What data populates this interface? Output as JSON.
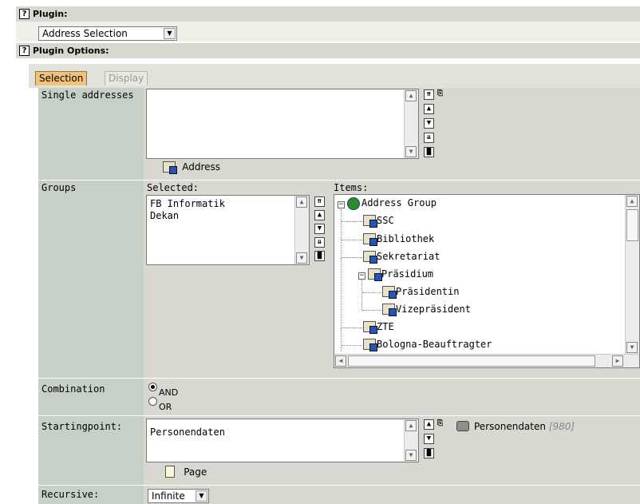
{
  "plugin": {
    "label": "Plugin:",
    "selected": "Address Selection"
  },
  "plugin_options": {
    "label": "Plugin Options:"
  },
  "tabs": [
    {
      "label": "Selection"
    },
    {
      "label": "Display"
    }
  ],
  "single_addresses": {
    "label": "Single addresses",
    "add_label": "Address"
  },
  "groups": {
    "label": "Groups",
    "selected_label": "Selected:",
    "items_label": "Items:",
    "selected": [
      "FB Informatik",
      "Dekan"
    ],
    "tree": [
      {
        "label": "Address Group"
      },
      {
        "label": "SSC"
      },
      {
        "label": "Bibliothek"
      },
      {
        "label": "Sekretariat"
      },
      {
        "label": "Präsidium"
      },
      {
        "label": "Präsidentin"
      },
      {
        "label": "Vizepräsident"
      },
      {
        "label": "ZTE"
      },
      {
        "label": "Bologna-Beauftragter"
      }
    ]
  },
  "combination": {
    "label": "Combination",
    "options": [
      {
        "label": "AND",
        "checked": true
      },
      {
        "label": "OR",
        "checked": false
      }
    ]
  },
  "startingpoint": {
    "label": "Startingpoint:",
    "value": "Personendaten",
    "ref_title": "Personendaten",
    "ref_id": "[980]",
    "add_label": "Page"
  },
  "recursive": {
    "label": "Recursive:",
    "selected": "Infinite"
  },
  "colors": {
    "header_bg": "#d8d8d0",
    "label_bg": "#c6d0c6",
    "tab_active": "#f3c27a"
  }
}
